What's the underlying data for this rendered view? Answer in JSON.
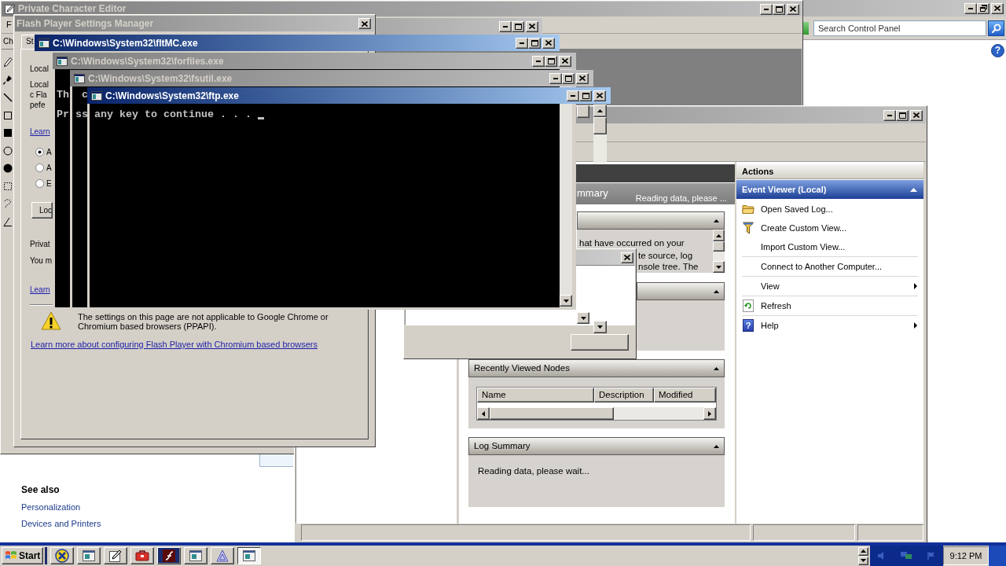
{
  "control_panel": {
    "active": false,
    "search": {
      "placeholder": "Search Control Panel"
    },
    "help_button": "?",
    "see_also": {
      "title": "See also",
      "links": [
        "Personalization",
        "Devices and Printers"
      ]
    }
  },
  "character_editor": {
    "title": "Private Character Editor",
    "active": false,
    "menu": [
      "F"
    ],
    "label": "Ch"
  },
  "background_window": {
    "active": false
  },
  "event_viewer": {
    "active": false,
    "summary": {
      "title": "mmary",
      "status": "Reading data, please ..."
    },
    "sections": [
      {
        "kind": "scrolling_text",
        "expanded": true,
        "lines": [
          "hat have occurred on your",
          "te source, log",
          "nsole tree. The"
        ]
      },
      {
        "kind": "empty",
        "expanded": true
      },
      {
        "kind": "table",
        "title": "Recently Viewed Nodes",
        "expanded": true,
        "columns": [
          "Name",
          "Description",
          "Modified"
        ]
      },
      {
        "kind": "text",
        "title": "Log Summary",
        "expanded": true,
        "lines": [
          "Reading data, please wait..."
        ]
      }
    ],
    "actions": {
      "title": "Actions",
      "group": {
        "title": "Event Viewer (Local)",
        "expanded": true
      },
      "items": [
        {
          "label": "Open Saved Log...",
          "submenu": false
        },
        {
          "label": "Create Custom View...",
          "submenu": false
        },
        {
          "label": "Import Custom View...",
          "submenu": false
        },
        {
          "label": "Connect to Another Computer...",
          "submenu": false
        },
        {
          "label": "View",
          "submenu": true
        },
        {
          "label": "Refresh",
          "submenu": false
        },
        {
          "label": "Help",
          "submenu": true,
          "glyph": "?"
        }
      ]
    }
  },
  "dialog": {
    "active": false
  },
  "flash_settings": {
    "title": "Flash Player Settings Manager",
    "active": false,
    "tabs": [
      {
        "label": "St",
        "selected": true
      }
    ],
    "heading": "Local",
    "paragraph": [
      "Local",
      "c Fla",
      "pefe"
    ],
    "link": "Learn",
    "radios": [
      {
        "label": "A",
        "selected": true
      },
      {
        "label": "A",
        "selected": false
      },
      {
        "label": "E",
        "selected": false
      }
    ],
    "button": "Loc",
    "private_heading": "Privat",
    "private_text": "You m",
    "private_link": "Learn",
    "warning": "The settings on this page are not applicable to Google Chrome or Chromium based browsers (PPAPI).",
    "more_link": "Learn more about configuring Flash Player with Chromium based browsers"
  },
  "consoles": [
    {
      "title": "C:\\Windows\\System32\\fltMC.exe",
      "active": true
    },
    {
      "title": "C:\\Windows\\System32\\forfiles.exe",
      "active": false,
      "lines": [
        "Th",
        "Pr"
      ]
    },
    {
      "title": "C:\\Windows\\System32\\fsutil.exe",
      "active": false,
      "lines": [
        "c",
        "ss"
      ]
    },
    {
      "title": "C:\\Windows\\System32\\ftp.exe",
      "active": true,
      "lines": [
        "any key to continue . . ."
      ],
      "cursor": true
    }
  ],
  "taskbar": {
    "start": "Start",
    "tasks": [
      {
        "selected": false,
        "flashing": false
      },
      {
        "selected": false,
        "flashing": false
      },
      {
        "selected": false,
        "flashing": false
      },
      {
        "selected": false,
        "flashing": false
      },
      {
        "selected": false,
        "flashing": true
      },
      {
        "selected": false,
        "flashing": false
      },
      {
        "selected": false,
        "flashing": false
      },
      {
        "selected": true,
        "flashing": false
      }
    ],
    "clock": "9:12 PM"
  }
}
